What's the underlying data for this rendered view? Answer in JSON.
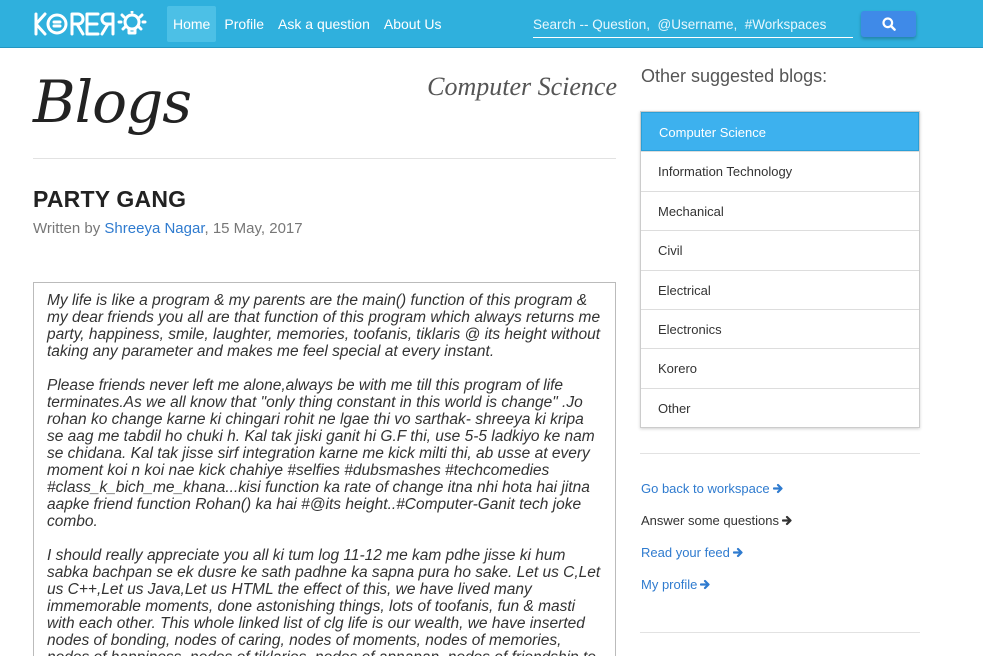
{
  "navbar": {
    "logo_text": "KORERO",
    "links": [
      {
        "label": "Home",
        "active": true
      },
      {
        "label": "Profile",
        "active": false
      },
      {
        "label": "Ask a question",
        "active": false
      },
      {
        "label": "About Us",
        "active": false
      }
    ],
    "search_placeholder": "Search -- Question,  @Username,  #Workspaces",
    "search_icon": "search-icon"
  },
  "page": {
    "heading": "Blogs",
    "category": "Computer Science"
  },
  "post": {
    "title": "PARTY GANG",
    "byline_prefix": "Written by ",
    "author": "Shreeya Nagar",
    "date": ", 15 May, 2017",
    "paragraphs": [
      "My life is like a program & my parents are the main() function of this program & my dear friends you all are that function of this program which always returns me party, happiness, smile, laughter, memories, toofanis, tiklaris @ its height without taking any parameter and makes me feel special at every instant.",
      "Please friends never left me alone,always be with me till this program of life terminates.As we all know that \"only thing constant in this world is change\" .Jo rohan ko change karne ki chingari rohit ne lgae thi vo sarthak- shreeya ki kripa se aag me tabdil ho chuki h. Kal tak jiski ganit hi G.F thi, use 5-5 ladkiyo ke nam se chidana. Kal tak jisse sirf integration karne me kick milti thi, ab usse at every moment koi n koi nae kick chahiye #selfies #dubsmashes #techcomedies #class_k_bich_me_khana...kisi function ka rate of change itna nhi hota hai jitna aapke friend function Rohan() ka hai #@its height..#Computer-Ganit tech joke combo.",
      "I should really appreciate you all ki tum log 11-12 me kam pdhe jisse ki hum sabka bachpan se ek dusre ke sath padhne ka sapna pura ho sake. Let us C,Let us C++,Let us Java,Let us HTML the effect of this, we have lived many immemorable moments, done astonishing things, lots of toofanis, fun & masti with each other. This whole linked list of clg life is our wealth, we have inserted nodes of bonding, nodes of caring, nodes of moments, nodes of memories, nodes of happiness, nodes of tiklaries, nodes of apnapan, nodes of friendship to"
    ]
  },
  "sidebar": {
    "heading": "Other suggested blogs:",
    "blogs": [
      {
        "label": "Computer Science",
        "active": true
      },
      {
        "label": "Information Technology",
        "active": false
      },
      {
        "label": "Mechanical",
        "active": false
      },
      {
        "label": "Civil",
        "active": false
      },
      {
        "label": "Electrical",
        "active": false
      },
      {
        "label": "Electronics",
        "active": false
      },
      {
        "label": "Korero",
        "active": false
      },
      {
        "label": "Other",
        "active": false
      }
    ],
    "links": [
      {
        "label": "Go back to workspace",
        "color": "#2f7bcf"
      },
      {
        "label": "Answer some questions",
        "color": "#333333"
      },
      {
        "label": "Read your feed",
        "color": "#2f7bcf"
      },
      {
        "label": "My profile",
        "color": "#2f7bcf"
      }
    ],
    "link_icon": "arrow-right-icon"
  },
  "colors": {
    "navbar": "#2fb0dd",
    "accent": "#3db1ee",
    "link": "#2f7bcf",
    "search_button": "#3f8ae8"
  }
}
